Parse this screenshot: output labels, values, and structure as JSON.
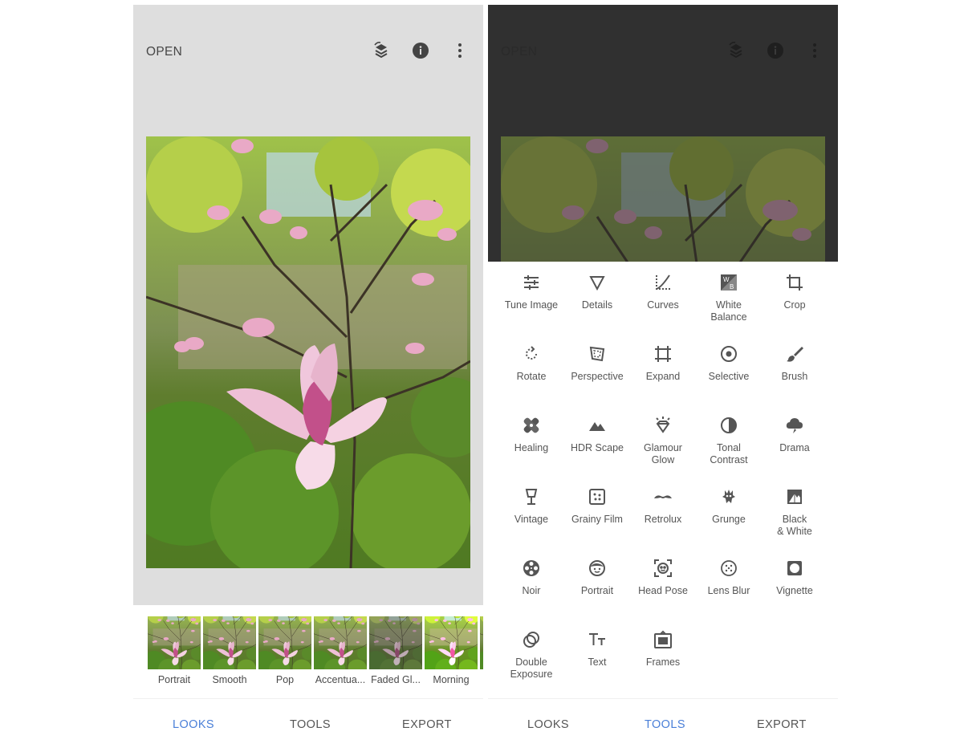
{
  "left": {
    "header": {
      "open_label": "OPEN"
    },
    "looks": [
      {
        "label": "Portrait"
      },
      {
        "label": "Smooth"
      },
      {
        "label": "Pop"
      },
      {
        "label": "Accentua..."
      },
      {
        "label": "Faded Gl..."
      },
      {
        "label": "Morning"
      }
    ],
    "nav": {
      "looks": "LOOKS",
      "tools": "TOOLS",
      "export": "EXPORT",
      "active": "LOOKS"
    }
  },
  "right": {
    "header": {
      "open_label": "OPEN"
    },
    "tools": [
      {
        "label": "Tune Image",
        "icon": "tune-image-icon"
      },
      {
        "label": "Details",
        "icon": "details-icon"
      },
      {
        "label": "Curves",
        "icon": "curves-icon"
      },
      {
        "label": "White\nBalance",
        "icon": "white-balance-icon"
      },
      {
        "label": "Crop",
        "icon": "crop-icon"
      },
      {
        "label": "Rotate",
        "icon": "rotate-icon"
      },
      {
        "label": "Perspective",
        "icon": "perspective-icon"
      },
      {
        "label": "Expand",
        "icon": "expand-icon"
      },
      {
        "label": "Selective",
        "icon": "selective-icon"
      },
      {
        "label": "Brush",
        "icon": "brush-icon"
      },
      {
        "label": "Healing",
        "icon": "healing-icon"
      },
      {
        "label": "HDR Scape",
        "icon": "hdr-scape-icon"
      },
      {
        "label": "Glamour\nGlow",
        "icon": "glamour-glow-icon"
      },
      {
        "label": "Tonal\nContrast",
        "icon": "tonal-contrast-icon"
      },
      {
        "label": "Drama",
        "icon": "drama-icon"
      },
      {
        "label": "Vintage",
        "icon": "vintage-icon"
      },
      {
        "label": "Grainy Film",
        "icon": "grainy-film-icon"
      },
      {
        "label": "Retrolux",
        "icon": "retrolux-icon"
      },
      {
        "label": "Grunge",
        "icon": "grunge-icon"
      },
      {
        "label": "Black\n& White",
        "icon": "black-white-icon"
      },
      {
        "label": "Noir",
        "icon": "noir-icon"
      },
      {
        "label": "Portrait",
        "icon": "portrait-icon"
      },
      {
        "label": "Head Pose",
        "icon": "head-pose-icon"
      },
      {
        "label": "Lens Blur",
        "icon": "lens-blur-icon"
      },
      {
        "label": "Vignette",
        "icon": "vignette-icon"
      },
      {
        "label": "Double\nExposure",
        "icon": "double-exposure-icon"
      },
      {
        "label": "Text",
        "icon": "text-icon"
      },
      {
        "label": "Frames",
        "icon": "frames-icon"
      }
    ],
    "nav": {
      "looks": "LOOKS",
      "tools": "TOOLS",
      "export": "EXPORT",
      "active": "TOOLS"
    }
  },
  "colors": {
    "accent": "#4a7fd8",
    "panel_bg": "#dedede",
    "dim_bg": "#3a3a3a"
  }
}
